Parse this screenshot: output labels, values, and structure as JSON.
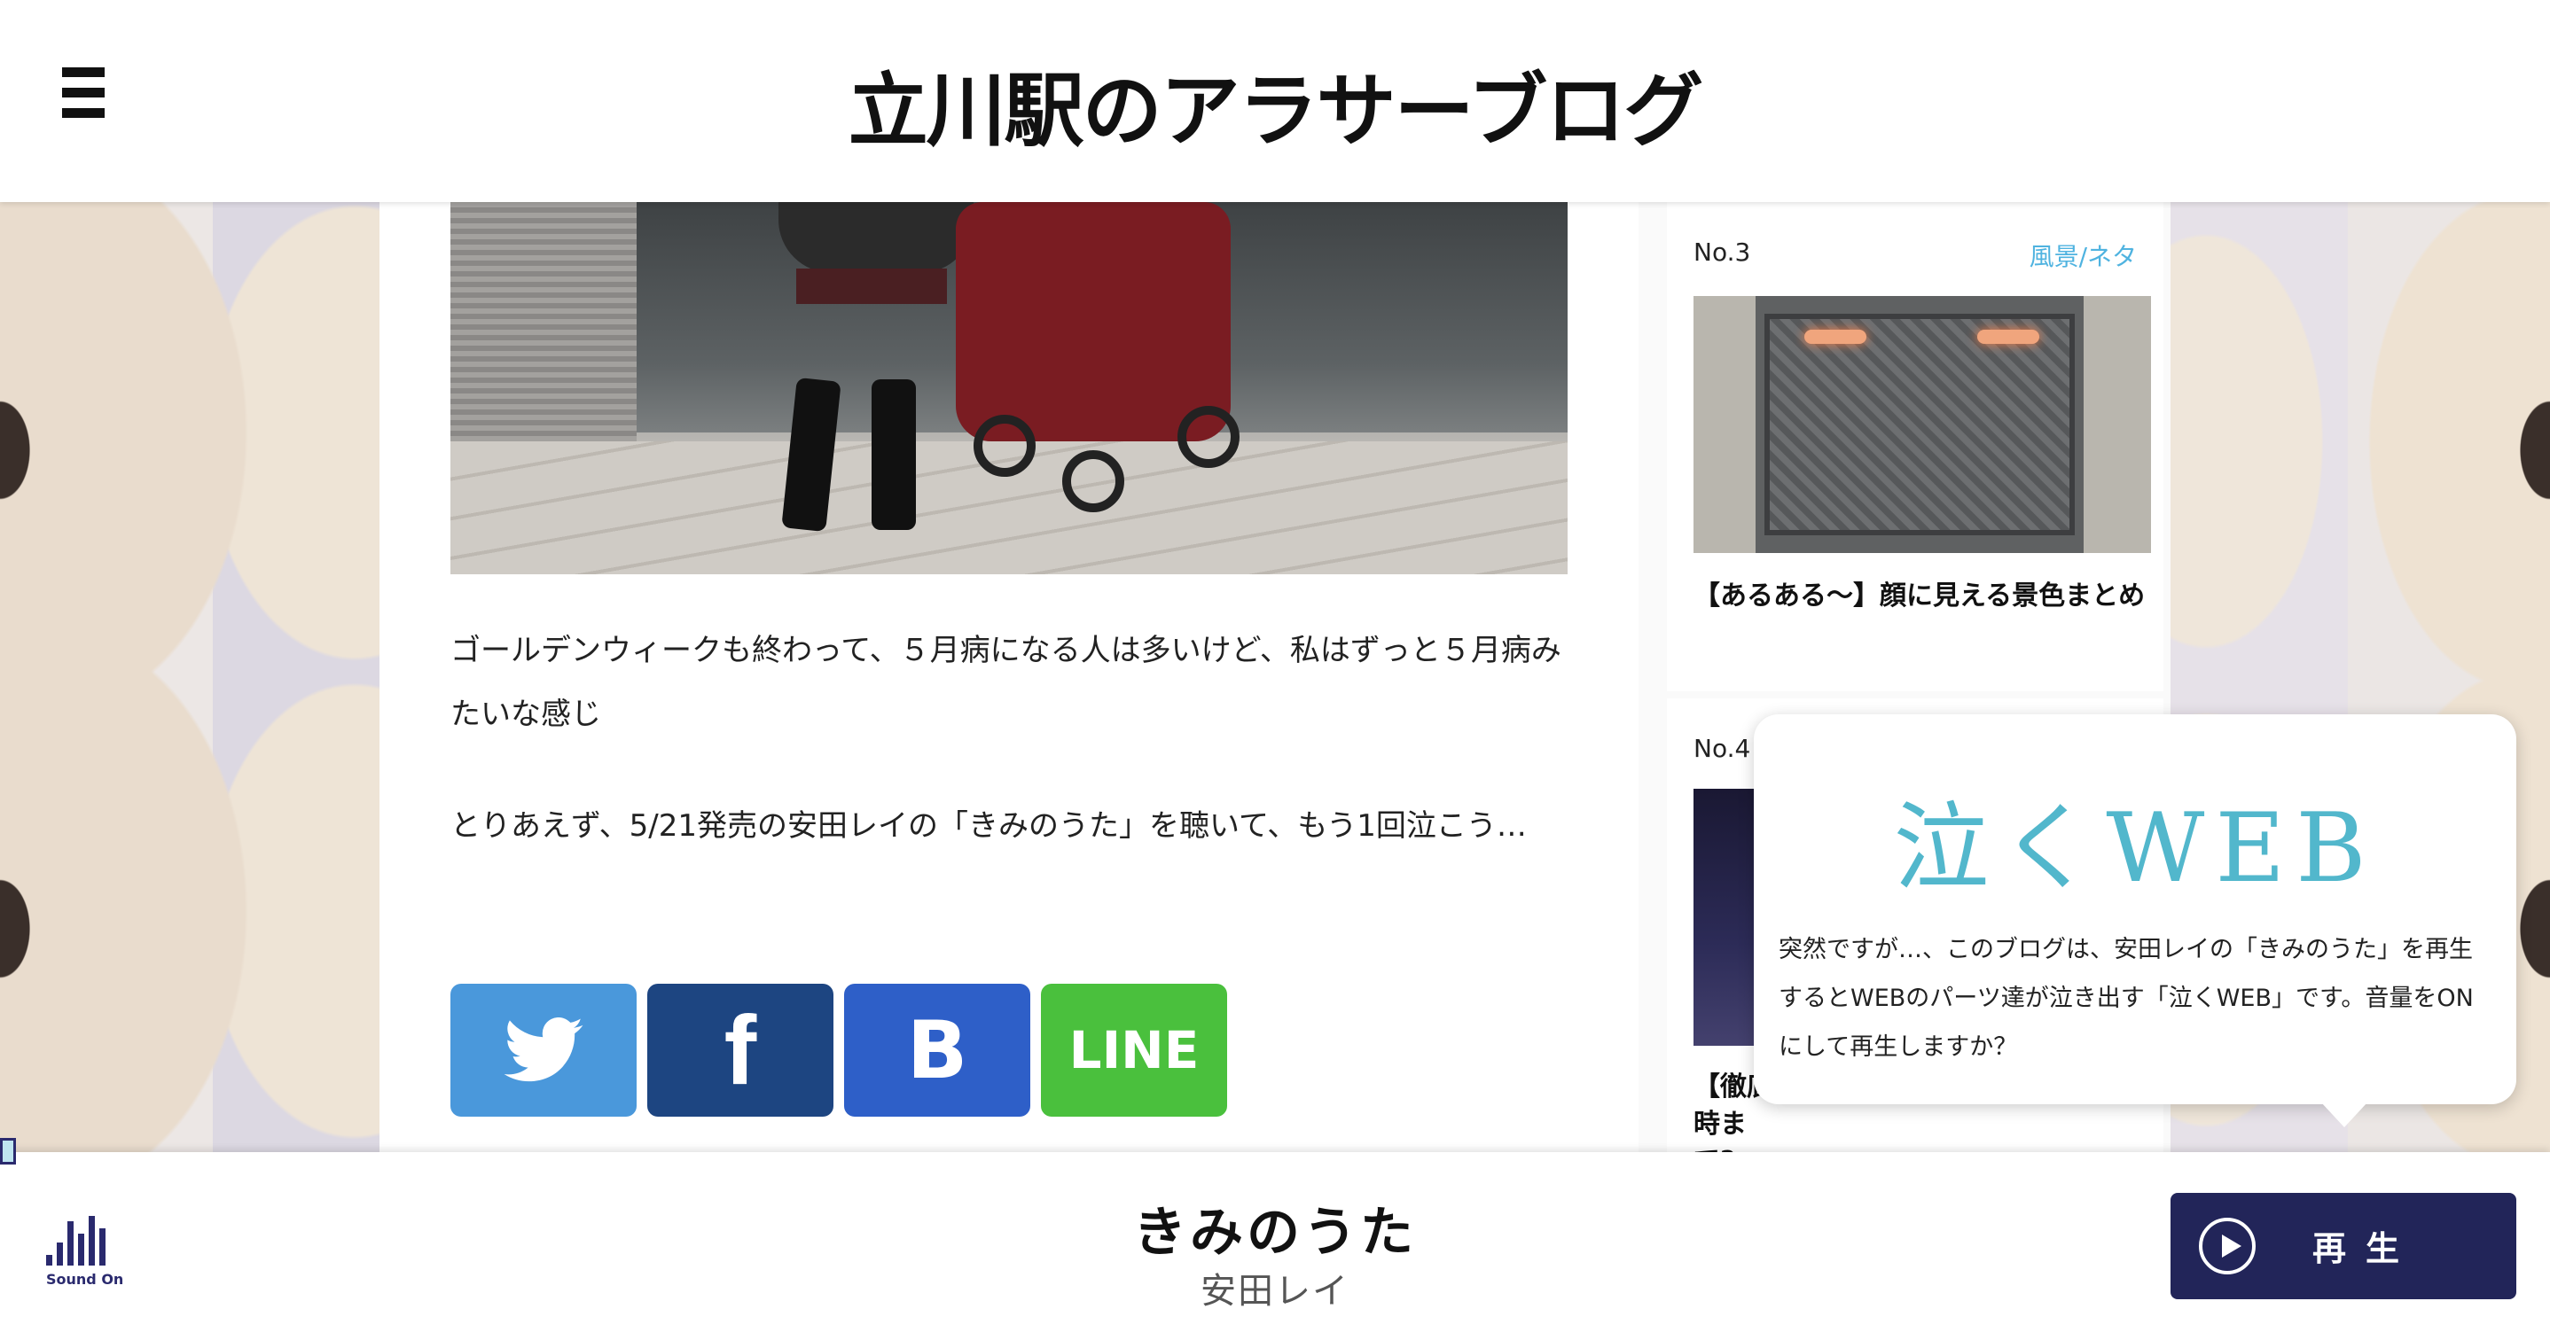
{
  "header": {
    "menu_icon": "hamburger-icon",
    "site_title": "立川駅のアラサーブログ"
  },
  "article": {
    "image_alt_icon": "stroller-photo",
    "paragraphs": [
      "ゴールデンウィークも終わって、５月病になる人は多いけど、私はずっと５月病みたいな感じ",
      "とりあえず、5/21発売の安田レイの「きみのうた」を聴いて、もう1回泣こう…"
    ],
    "share": {
      "twitter_icon": "twitter-bird-icon",
      "facebook_label": "f",
      "hatena_label": "B",
      "line_label": "LINE"
    }
  },
  "ranking": {
    "items": [
      {
        "no": "No.3",
        "category": "風景/ネタ",
        "title": "【あるある〜】顔に見える景色まとめ",
        "thumb": "manhole-photo"
      },
      {
        "no": "No.4",
        "category": "",
        "title": "【徹底\n時まで?",
        "thumb": "night-city-photo"
      }
    ]
  },
  "popup": {
    "logo": "泣くWEB",
    "message": "突然ですが…、このブログは、安田レイの「きみのうた」を再生するとWEBのパーツ達が泣き出す「泣くWEB」です。音量をONにして再生しますか？"
  },
  "player": {
    "sound_label": "Sound On",
    "song_title": "きみのうた",
    "artist": "安田レイ",
    "play_label": "再生"
  },
  "colors": {
    "accent_category": "#4fb3e0",
    "play_button": "#222559",
    "twitter": "#4a98db",
    "facebook": "#1d4581",
    "hatena": "#2e5fc8",
    "line": "#4ac03d",
    "logo": "#52b7cc"
  }
}
